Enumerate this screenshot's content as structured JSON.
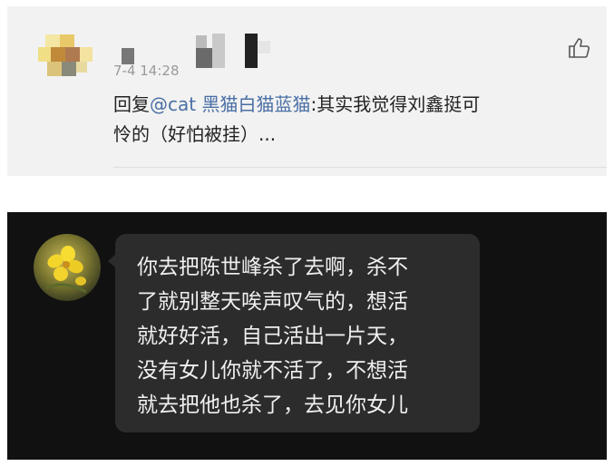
{
  "comment": {
    "timestamp": "7-4 14:28",
    "reply_prefix": "回复",
    "mention": "@cat 黑猫白猫蓝猫",
    "text_line1": ":其实我觉得刘鑫挺可",
    "text_line2": "怜的（好怕被挂）...",
    "like_icon": "thumbs-up-icon"
  },
  "chat": {
    "avatar": "flower-avatar",
    "message_lines": [
      "你去把陈世峰杀了去啊，杀不",
      "了就别整天唉声叹气的，想活",
      "就好好活，自己活出一片天，",
      "没有女儿你就不活了，不想活",
      "就去把他也杀了，去见你女儿"
    ],
    "bubble_color": "#2c2c2c",
    "background_color": "#111111"
  }
}
